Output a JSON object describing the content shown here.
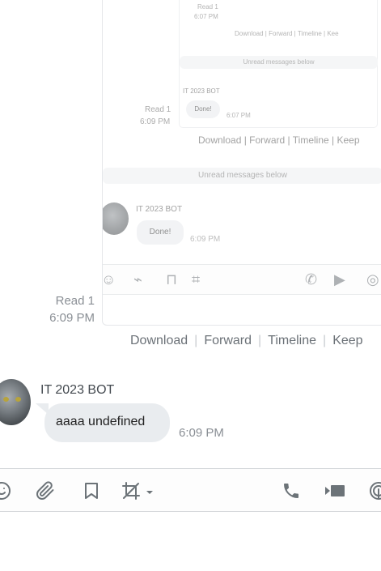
{
  "embedded_screenshot": {
    "read_top": "Read 1",
    "time_top": "6:07 PM",
    "actions_top": [
      "Download",
      "Forward",
      "Timeline",
      "Kee"
    ],
    "unread_small": "Unread messages below",
    "sender_small": "IT 2023 BOT",
    "read_mid": "Read 1",
    "time_mid_left": "6:09 PM",
    "bubble_small": "Done!",
    "time_small": "6:07 PM",
    "actions_mid": [
      "Download",
      "Forward",
      "Timeline",
      "Keep"
    ],
    "unread_mid": "Unread messages below",
    "sender_mid": "IT 2023 BOT",
    "bubble_mid": "Done!",
    "time_mid": "6:09 PM"
  },
  "outer_meta": {
    "read": "Read 1",
    "time": "6:09 PM"
  },
  "actions": {
    "download": "Download",
    "forward": "Forward",
    "timeline": "Timeline",
    "keep": "Keep"
  },
  "message": {
    "sender": "IT 2023 BOT",
    "text": "aaaa undefined",
    "time": "6:09 PM"
  },
  "toolbar": {
    "icons": [
      "emoji-icon",
      "attach-icon",
      "bookmark-icon",
      "crop-icon",
      "phone-icon",
      "video-icon",
      "audio-icon"
    ]
  }
}
